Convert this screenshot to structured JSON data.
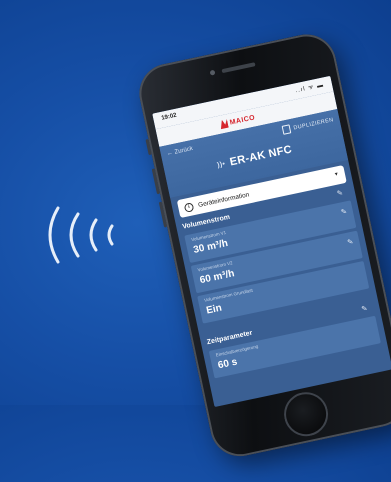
{
  "status_bar": {
    "time": "19:02",
    "icons": "..ıl ᯤ ▬"
  },
  "brand": {
    "logo_text": "MAICO",
    "color": "#d6262e"
  },
  "header": {
    "back_label": "Zurück",
    "duplicate_label": "DUPLIZIEREN",
    "device_title": "ER-AK NFC",
    "nfc_badge": "))•"
  },
  "dropdown": {
    "selected": "Geräteinformation"
  },
  "sections": [
    {
      "title": "Volumenstrom",
      "fields": [
        {
          "label": "Volumenstrom V1",
          "value": "30 m³/h"
        },
        {
          "label": "Volumenstrom V2",
          "value": "60 m³/h"
        },
        {
          "label": "Volumenstrom Grundlast",
          "value": "Ein"
        }
      ]
    },
    {
      "title": "Zeitparameter",
      "fields": [
        {
          "label": "Einschaltverzögerung",
          "value": "60 s"
        }
      ]
    }
  ],
  "icons": {
    "back": "arrow-left-icon",
    "copy": "copy-icon",
    "info": "info-icon",
    "chevron": "chevron-down-icon",
    "edit": "pencil-icon",
    "nfc_waves": "nfc-waves-icon"
  },
  "colors": {
    "background": "#164fa6",
    "screen_bg": "#3a5f93",
    "card_bg": "#4b74aa"
  }
}
